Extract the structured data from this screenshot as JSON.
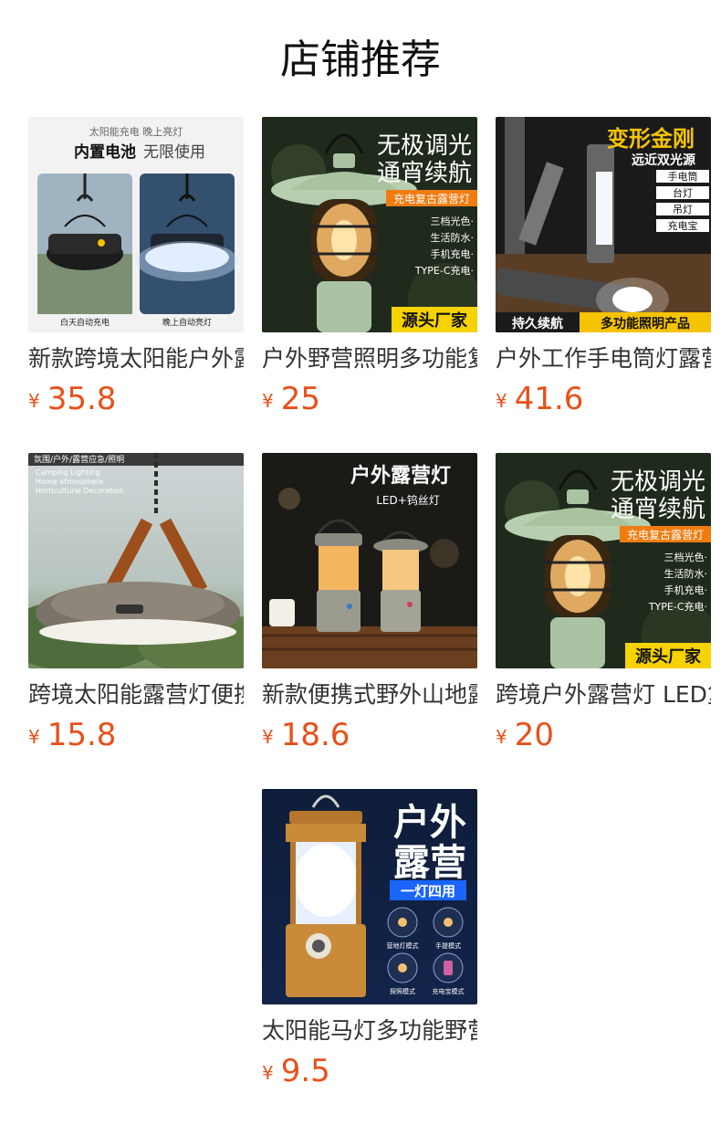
{
  "page": {
    "title": "店铺推荐"
  },
  "currency_symbol": "¥",
  "accent_color": "#e8501a",
  "products": [
    {
      "name": "新款跨境太阳能户外露营灯",
      "price": "35.8",
      "image_text": {
        "line1": "太阳能充电  晚上亮灯",
        "line2a": "内置电池",
        "line2b": "无限使用",
        "cap_left": "白天自动充电",
        "cap_right": "晚上自动亮灯"
      }
    },
    {
      "name": "户外野营照明多功能复古露营灯",
      "price": "25",
      "image_text": {
        "head1": "无极调光",
        "head2": "通宵续航",
        "tag": "充电复古露营灯",
        "f1": "三档光色·",
        "f2": "生活防水·",
        "f3": "手机充电·",
        "f4": "TYPE-C充电·",
        "badge": "源头厂家"
      }
    },
    {
      "name": "户外工作手电筒灯露营灯",
      "price": "41.6",
      "image_text": {
        "head1": "变形金刚",
        "head2": "远近双光源",
        "m1": "手电筒",
        "m2": "台灯",
        "m3": "吊灯",
        "m4": "充电宝",
        "bottom_left": "持久续航",
        "bottom_right": "多功能照明产品"
      }
    },
    {
      "name": "跨境太阳能露营灯便携式",
      "price": "15.8",
      "image_text": {
        "line1": "氛围/户外/露营应急/照明",
        "line2": "Camping Lighting",
        "line3": "Home atmosphere",
        "line4": "Horticultural Decoration"
      }
    },
    {
      "name": "新款便携式野外山地露营灯",
      "price": "18.6",
      "image_text": {
        "head": "户外露营灯",
        "sub": "LED+钨丝灯"
      }
    },
    {
      "name": "跨境户外露营灯 LED复古马灯",
      "price": "20",
      "image_text": {
        "head1": "无极调光",
        "head2": "通宵续航",
        "tag": "充电复古露营灯",
        "f1": "三档光色·",
        "f2": "生活防水·",
        "f3": "手机充电·",
        "f4": "TYPE-C充电·",
        "badge": "源头厂家"
      }
    },
    {
      "name": "太阳能马灯多功能野营灯",
      "price": "9.5",
      "image_text": {
        "head1": "户外",
        "head2": "露营",
        "banner": "一灯四用",
        "i1": "营地灯模式",
        "i2": "手提模式",
        "i3": "探照模式",
        "i4": "充电宝模式"
      }
    }
  ]
}
